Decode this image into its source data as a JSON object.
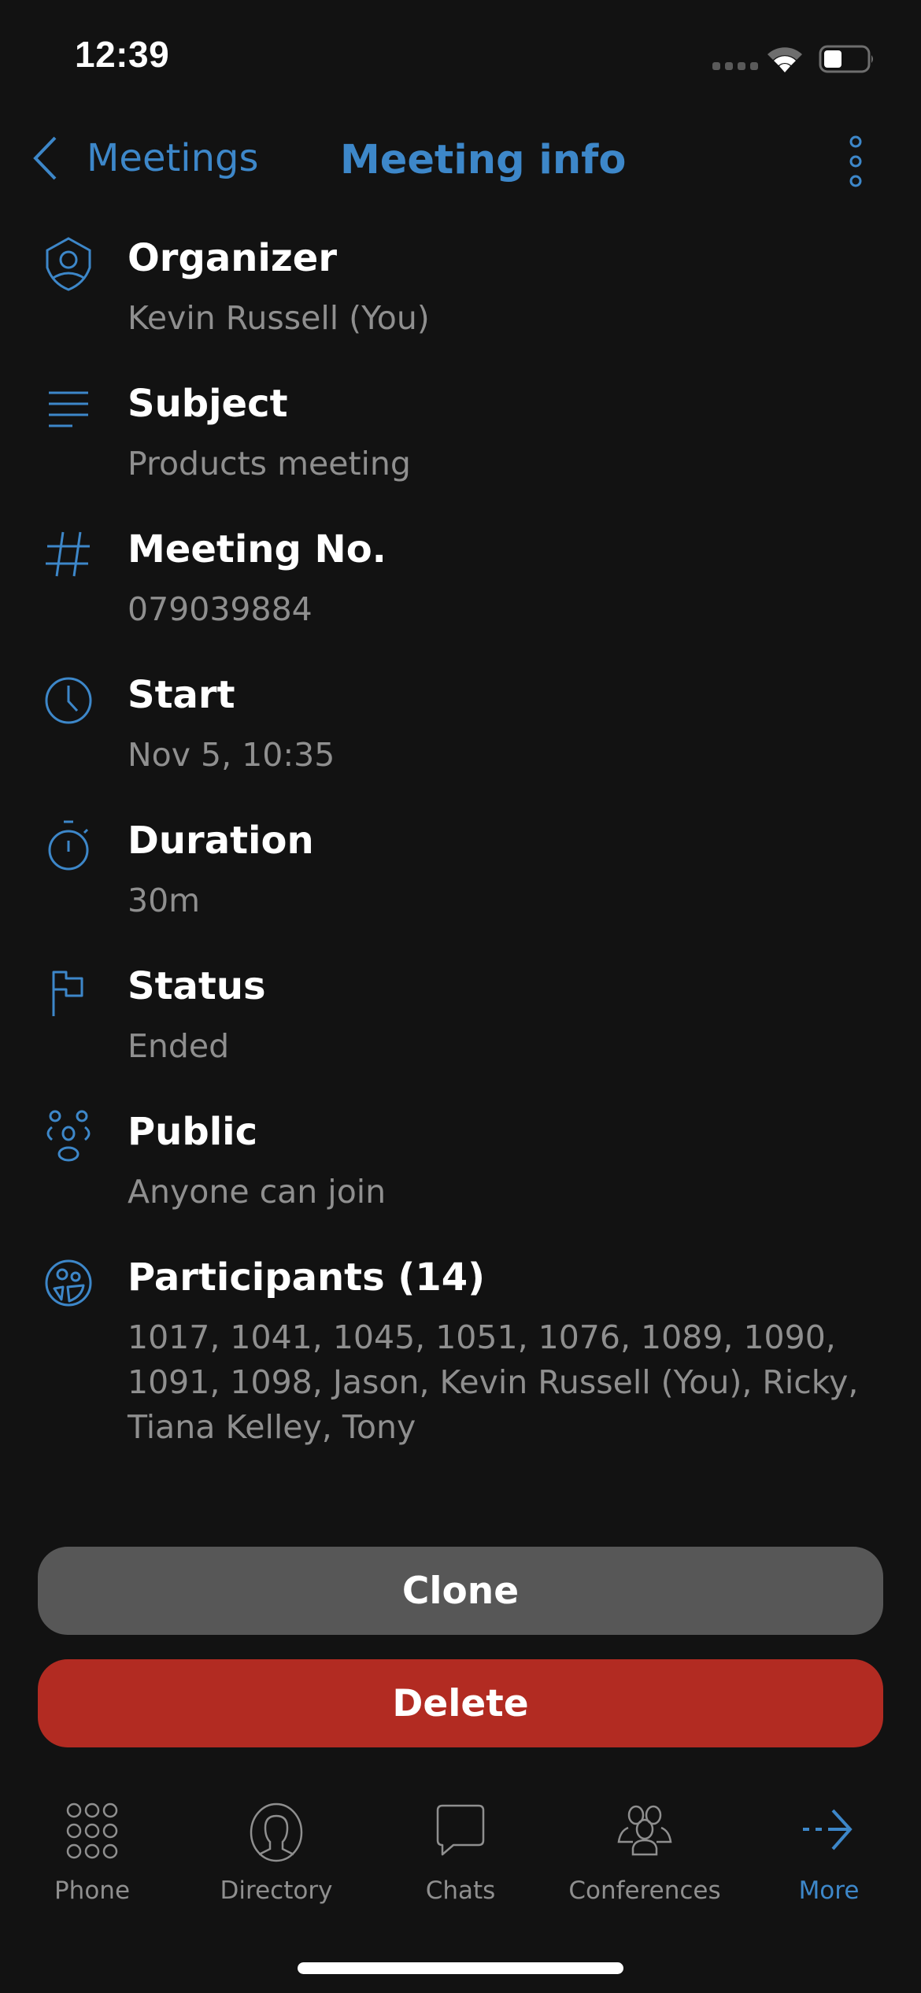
{
  "status_bar": {
    "time": "12:39",
    "wifi_icon": "wifi-icon",
    "battery_icon": "battery-icon",
    "battery_level": 0.3
  },
  "nav": {
    "back_label": "Meetings",
    "title": "Meeting info",
    "back_icon": "chevron-left-icon",
    "menu_icon": "kebab-menu-icon"
  },
  "accent_color": "#3d87c9",
  "fields": [
    {
      "icon": "shield-user-icon",
      "label": "Organizer",
      "value": "Kevin Russell (You)"
    },
    {
      "icon": "text-lines-icon",
      "label": "Subject",
      "value": "Products meeting"
    },
    {
      "icon": "hash-icon",
      "label": "Meeting No.",
      "value": "079039884"
    },
    {
      "icon": "clock-icon",
      "label": "Start",
      "value": "Nov 5, 10:35"
    },
    {
      "icon": "stopwatch-icon",
      "label": "Duration",
      "value": "30m"
    },
    {
      "icon": "flag-icon",
      "label": "Status",
      "value": "Ended"
    },
    {
      "icon": "group-icon",
      "label": "Public",
      "value": "Anyone can join"
    },
    {
      "icon": "participants-icon",
      "label": "Participants (14)",
      "value": "1017, 1041, 1045, 1051, 1076, 1089, 1090, 1091, 1098, Jason, Kevin Russell (You), Ricky, Tiana Kelley, Tony"
    }
  ],
  "actions": {
    "clone_label": "Clone",
    "delete_label": "Delete",
    "delete_color": "#b22b22",
    "clone_color": "#575757"
  },
  "tab_bar": {
    "items": [
      {
        "label": "Phone",
        "icon": "keypad-icon",
        "active": false
      },
      {
        "label": "Directory",
        "icon": "person-circle-icon",
        "active": false
      },
      {
        "label": "Chats",
        "icon": "chat-bubble-icon",
        "active": false
      },
      {
        "label": "Conferences",
        "icon": "people-group-icon",
        "active": false
      },
      {
        "label": "More",
        "icon": "dashed-arrow-right-icon",
        "active": true
      }
    ]
  }
}
